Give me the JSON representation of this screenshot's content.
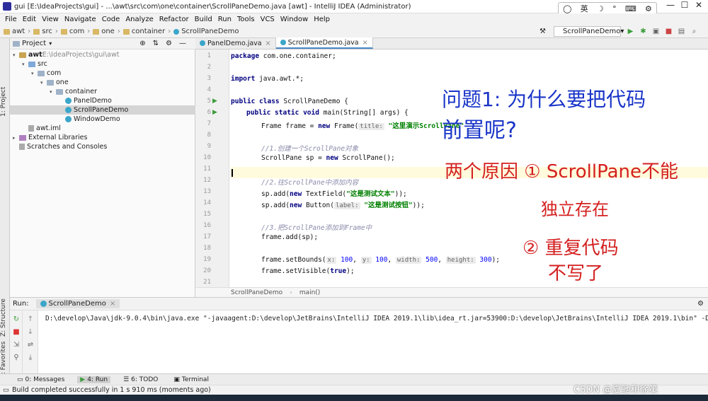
{
  "window": {
    "title": "gui [E:\\IdeaProjects\\gui] - ...\\awt\\src\\com\\one\\container\\ScrollPaneDemo.java [awt] - IntelliJ IDEA (Administrator)",
    "ime": {
      "mode": "英",
      "items": [
        "☽",
        "°",
        "⌨",
        "⚙"
      ]
    },
    "min": "—",
    "max": "☐",
    "close": "✕"
  },
  "menu": [
    "File",
    "Edit",
    "View",
    "Navigate",
    "Code",
    "Analyze",
    "Refactor",
    "Build",
    "Run",
    "Tools",
    "VCS",
    "Window",
    "Help"
  ],
  "breadcrumb": [
    "awt",
    "src",
    "com",
    "one",
    "container",
    "ScrollPaneDemo"
  ],
  "run_config": "ScrollPaneDemo",
  "left_tabs": {
    "project": "1: Project",
    "structure": "Z: Structure",
    "favorites": "2: Favorites"
  },
  "project": {
    "header": "Project",
    "tree": [
      {
        "label": "awt",
        "extra": "E:\\IdeaProjects\\gui\\awt",
        "level": 0,
        "icon": "module-folder-icon",
        "arrow": "▾"
      },
      {
        "label": "src",
        "level": 1,
        "icon": "source-folder-icon",
        "arrow": "▾"
      },
      {
        "label": "com",
        "level": 2,
        "icon": "package-icon",
        "arrow": "▾"
      },
      {
        "label": "one",
        "level": 3,
        "icon": "package-icon",
        "arrow": "▾"
      },
      {
        "label": "container",
        "level": 4,
        "icon": "package-icon",
        "arrow": "▾"
      },
      {
        "label": "PanelDemo",
        "level": 5,
        "icon": "class-icon",
        "arrow": ""
      },
      {
        "label": "ScrollPaneDemo",
        "level": 5,
        "icon": "class-icon",
        "arrow": "",
        "selected": true
      },
      {
        "label": "WindowDemo",
        "level": 5,
        "icon": "class-icon",
        "arrow": ""
      },
      {
        "label": "awt.iml",
        "level": 1,
        "icon": "iml-file-icon",
        "arrow": ""
      },
      {
        "label": "External Libraries",
        "level": 0,
        "icon": "library-icon",
        "arrow": "▸"
      },
      {
        "label": "Scratches and Consoles",
        "level": 0,
        "icon": "scratches-icon",
        "arrow": ""
      }
    ]
  },
  "editor": {
    "tabs": [
      "PanelDemo.java",
      "ScrollPaneDemo.java"
    ],
    "active_tab": 1,
    "line_numbers": [
      "1",
      "2",
      "3",
      "4",
      "5",
      "6",
      "7",
      "8",
      "9",
      "10",
      "11",
      "12",
      "13",
      "14",
      "15",
      "16",
      "17",
      "18",
      "19",
      "20",
      "21"
    ],
    "code": {
      "l1_kw": "package",
      "l1_rest": " com.one.container;",
      "l3_kw": "import",
      "l3_rest": " java.awt.*;",
      "l5_kw": "public class",
      "l5_rest": " ScrollPaneDemo {",
      "l6_kw": "public static void",
      "l6_rest": " main(String[] args) {",
      "l7_a": "Frame frame = ",
      "l7_kw": "new",
      "l7_b": " Frame(",
      "l7_hint": "title:",
      "l7_str": " \"这里演示ScrollPane\"",
      "l9_cm": "//1.创建一个ScrollPane对象",
      "l10": "ScrollPane sp = ",
      "l10_kw": "new",
      "l10_b": " ScrollPane();",
      "l12_cm": "//2.往ScrollPane中添加内容",
      "l13_a": "sp.add(",
      "l13_kw": "new",
      "l13_b": " TextField(",
      "l13_str": "\"这是测试文本\"",
      "l13_c": "));",
      "l14_a": "sp.add(",
      "l14_kw": "new",
      "l14_b": " Button(",
      "l14_hint": "label:",
      "l14_str": " \"这是测试按钮\"",
      "l14_c": "));",
      "l16_cm": "//3.把ScrollPane添加到Frame中",
      "l17": "frame.add(sp);",
      "l19_a": "frame.setBounds(",
      "l19_h1": "x:",
      "l19_v1": " 100",
      "l19_h2": "y:",
      "l19_v2": " 100",
      "l19_h3": "width:",
      "l19_v3": " 500",
      "l19_h4": "height:",
      "l19_v4": " 300",
      "l19_end": ");",
      "l20_a": "frame.setVisible(",
      "l20_kw": "true",
      "l20_b": ");"
    },
    "footer": [
      "ScrollPaneDemo",
      "main()"
    ]
  },
  "annotations": {
    "q1_line1": "问题1: 为什么要把代码",
    "q1_line2": "前置呢?",
    "a1": "两个原因 ① ScrollPane不能",
    "a1b": "独立存在",
    "a2": "② 重复代码",
    "a2b": "不写了"
  },
  "run": {
    "label": "Run:",
    "tab": "ScrollPaneDemo",
    "console": "D:\\develop\\Java\\jdk-9.0.4\\bin\\java.exe \"-javaagent:D:\\develop\\JetBrains\\IntelliJ IDEA 2019.1\\lib\\idea_rt.jar=53900:D:\\develop\\JetBrains\\IntelliJ IDEA 2019.1\\bin\" -Dfile.encod"
  },
  "bottom_tabs": [
    "0: Messages",
    "4: Run",
    "6: TODO",
    "Terminal"
  ],
  "status": "Build completed successfully in 1 s 910 ms (moments ago)",
  "watermark": "CSDN @夏驰和徐策"
}
